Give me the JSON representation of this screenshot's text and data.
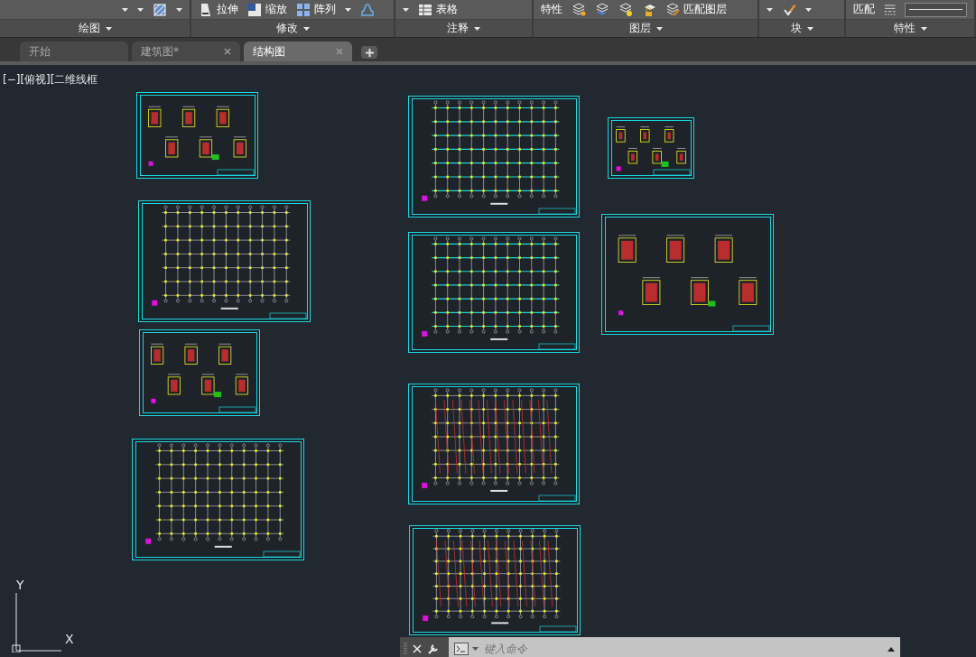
{
  "ribbon": {
    "panels": [
      {
        "title": "绘图",
        "tools": [
          {
            "kind": "caret"
          },
          {
            "kind": "caret"
          },
          {
            "kind": "icon"
          },
          {
            "kind": "caret"
          }
        ]
      },
      {
        "title": "修改",
        "tools": [
          {
            "kind": "button",
            "label": "拉伸"
          },
          {
            "kind": "button",
            "label": "缩放"
          },
          {
            "kind": "button",
            "label": "阵列"
          },
          {
            "kind": "caret"
          },
          {
            "kind": "icon"
          }
        ]
      },
      {
        "title": "注释",
        "tools": [
          {
            "kind": "caret"
          },
          {
            "kind": "button",
            "label": "表格"
          }
        ]
      },
      {
        "title": "图层",
        "tools": [
          {
            "kind": "label",
            "label": "特性"
          },
          {
            "kind": "icon"
          },
          {
            "kind": "icon"
          },
          {
            "kind": "icon"
          },
          {
            "kind": "icon"
          },
          {
            "kind": "button",
            "label": "匹配图层"
          }
        ]
      },
      {
        "title": "块",
        "tools": [
          {
            "kind": "caret"
          },
          {
            "kind": "icon"
          },
          {
            "kind": "caret"
          }
        ]
      },
      {
        "title": "特性",
        "tools": [
          {
            "kind": "label",
            "label": "匹配"
          },
          {
            "kind": "icon"
          },
          {
            "kind": "linetype"
          }
        ]
      }
    ]
  },
  "tabs": [
    {
      "label": "开始",
      "selected": false,
      "closable": false
    },
    {
      "label": "建筑图*",
      "selected": false,
      "closable": true
    },
    {
      "label": "结构图",
      "selected": true,
      "closable": true
    }
  ],
  "viewport": {
    "label": "[−][俯视][二维线框",
    "axis_y": "Y",
    "axis_x": "X"
  },
  "command_line": {
    "placeholder": "键入命令"
  }
}
